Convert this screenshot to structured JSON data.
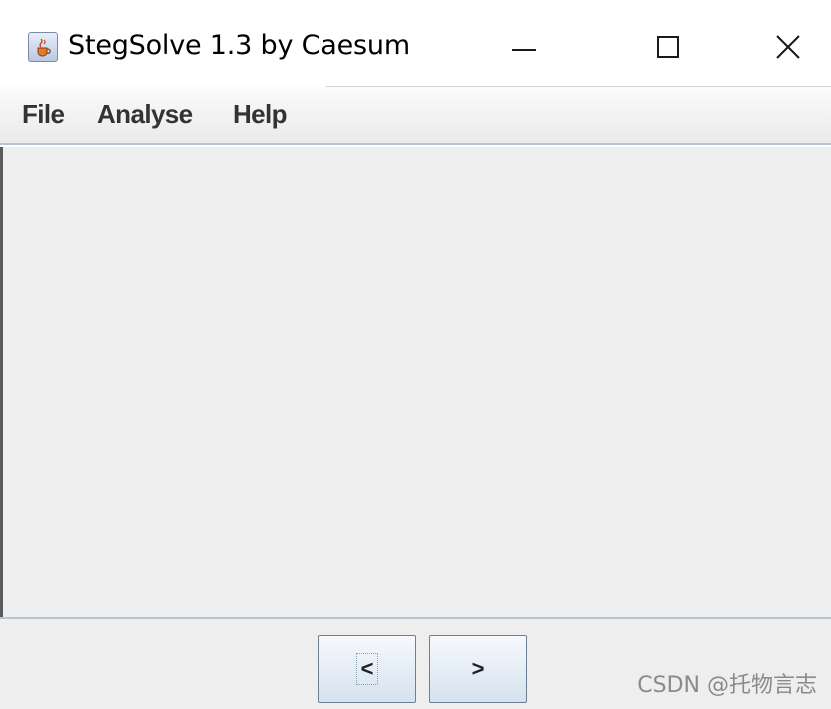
{
  "window": {
    "title": "StegSolve 1.3 by Caesum",
    "icon": "java-coffee-icon",
    "controls": {
      "minimize": "minimize-icon",
      "maximize": "maximize-icon",
      "close": "close-icon"
    }
  },
  "menubar": {
    "items": [
      {
        "label": "File"
      },
      {
        "label": "Analyse"
      },
      {
        "label": "Help"
      }
    ]
  },
  "navigation": {
    "prev_label": "<",
    "next_label": ">"
  },
  "watermark": "CSDN @托物言志",
  "colors": {
    "panel_background": "#eeeeee",
    "menu_text": "#333333",
    "button_border": "#6d7f95"
  }
}
